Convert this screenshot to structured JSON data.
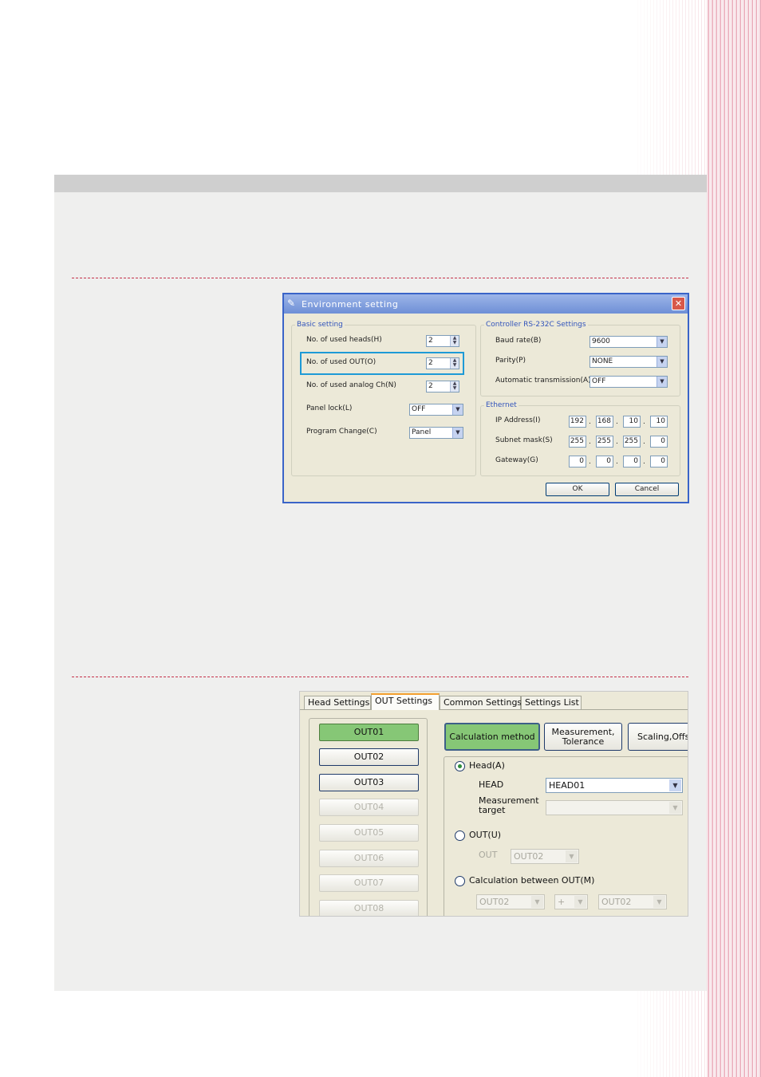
{
  "env_dialog": {
    "title": "Environment setting",
    "close_glyph": "✕",
    "basic": {
      "label": "Basic setting",
      "heads_label": "No. of used heads(H)",
      "heads_value": "2",
      "out_label": "No. of used OUT(O)",
      "out_value": "2",
      "analog_label": "No. of used analog Ch(N)",
      "analog_value": "2",
      "panel_lock_label": "Panel lock(L)",
      "panel_lock_value": "OFF",
      "program_change_label": "Program Change(C)",
      "program_change_value": "Panel"
    },
    "rs232c": {
      "label": "Controller RS-232C Settings",
      "baud_label": "Baud rate(B)",
      "baud_value": "9600",
      "parity_label": "Parity(P)",
      "parity_value": "NONE",
      "auto_tx_label": "Automatic transmission(A)",
      "auto_tx_value": "OFF"
    },
    "ethernet": {
      "label": "Ethernet",
      "ip_label": "IP Address(I)",
      "ip": [
        "192",
        "168",
        "10",
        "10"
      ],
      "subnet_label": "Subnet mask(S)",
      "subnet": [
        "255",
        "255",
        "255",
        "0"
      ],
      "gateway_label": "Gateway(G)",
      "gateway": [
        "0",
        "0",
        "0",
        "0"
      ]
    },
    "ok_label": "OK",
    "cancel_label": "Cancel"
  },
  "out_settings": {
    "tabs": [
      "Head Settings",
      "OUT Settings",
      "Common Settings",
      "Settings List"
    ],
    "outs": [
      "OUT01",
      "OUT02",
      "OUT03",
      "OUT04",
      "OUT05",
      "OUT06",
      "OUT07",
      "OUT08"
    ],
    "method_buttons": [
      "Calculation method",
      "Measurement,",
      "Tolerance",
      "Scaling,Offs"
    ],
    "head_radio_label": "Head(A)",
    "head_label": "HEAD",
    "head_value": "HEAD01",
    "meas_target_label_1": "Measurement",
    "meas_target_label_2": "target",
    "out_radio_label": "OUT(U)",
    "out_label": "OUT",
    "out_value": "OUT02",
    "calc_between_label": "Calculation between OUT(M)",
    "calc_a": "OUT02",
    "calc_op": "+",
    "calc_b": "OUT02"
  }
}
